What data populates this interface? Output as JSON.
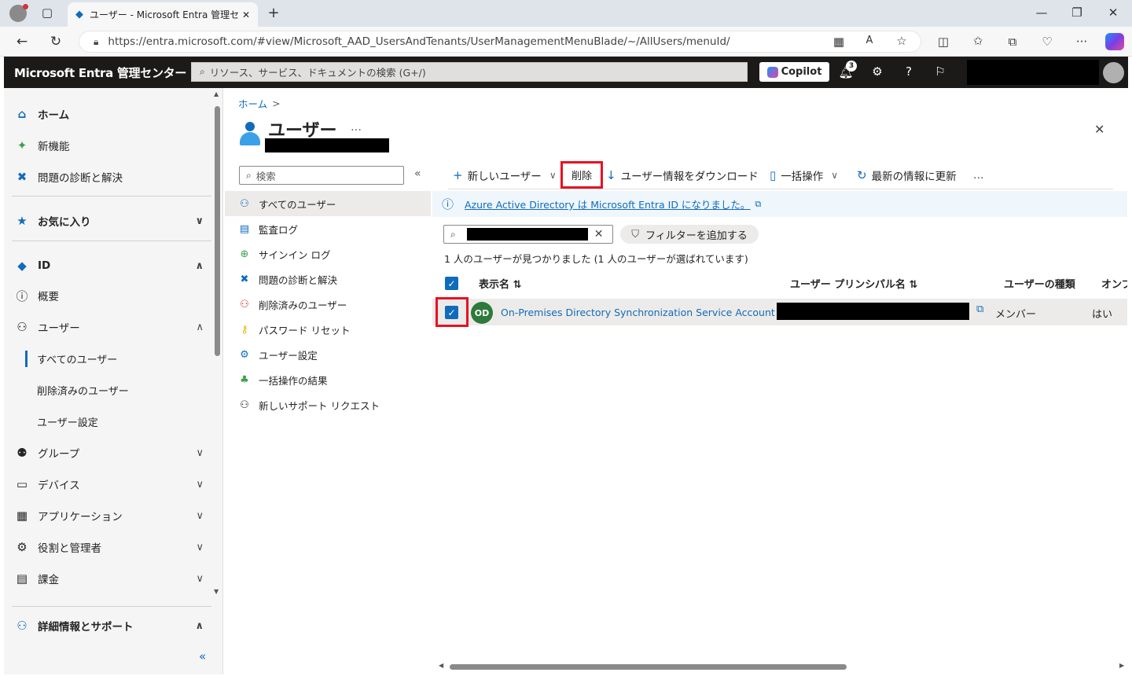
{
  "browser": {
    "tab_title": "ユーザー - Microsoft Entra 管理セン…",
    "url": "https://entra.microsoft.com/#view/Microsoft_AAD_UsersAndTenants/UserManagementMenuBlade/~/AllUsers/menuId/"
  },
  "header": {
    "brand": "Microsoft Entra 管理センター",
    "search_placeholder": "リソース、サービス、ドキュメントの検索 (G+/)",
    "copilot_label": "Copilot",
    "notification_count": "3"
  },
  "left_nav": {
    "items": [
      {
        "label": "ホーム",
        "icon": "home-icon"
      },
      {
        "label": "新機能",
        "icon": "sparkle-icon"
      },
      {
        "label": "問題の診断と解決",
        "icon": "diagnose-icon"
      },
      {
        "label": "お気に入り",
        "icon": "star-icon"
      },
      {
        "label": "ID",
        "icon": "identity-icon"
      },
      {
        "label": "概要",
        "icon": "info-icon"
      },
      {
        "label": "ユーザー",
        "icon": "user-icon"
      },
      {
        "label": "すべてのユーザー"
      },
      {
        "label": "削除済みのユーザー"
      },
      {
        "label": "ユーザー設定"
      },
      {
        "label": "グループ",
        "icon": "group-icon"
      },
      {
        "label": "デバイス",
        "icon": "device-icon"
      },
      {
        "label": "アプリケーション",
        "icon": "apps-icon"
      },
      {
        "label": "役割と管理者",
        "icon": "roles-icon"
      },
      {
        "label": "課金",
        "icon": "billing-icon"
      },
      {
        "label": "詳細情報とサポート",
        "icon": "support-icon"
      }
    ]
  },
  "breadcrumb": {
    "home": "ホーム",
    "sep": ">"
  },
  "page": {
    "title": "ユーザー",
    "more": "…",
    "close": "✕"
  },
  "resource_menu": {
    "search_placeholder": "検索",
    "collapse": "«",
    "items": [
      {
        "label": "すべてのユーザー",
        "icon": "users-icon"
      },
      {
        "label": "監査ログ",
        "icon": "audit-log-icon"
      },
      {
        "label": "サインイン ログ",
        "icon": "signin-log-icon"
      },
      {
        "label": "問題の診断と解決",
        "icon": "diagnose-icon"
      },
      {
        "label": "削除済みのユーザー",
        "icon": "deleted-user-icon"
      },
      {
        "label": "パスワード リセット",
        "icon": "key-icon"
      },
      {
        "label": "ユーザー設定",
        "icon": "user-settings-icon"
      },
      {
        "label": "一括操作の結果",
        "icon": "bulk-results-icon"
      },
      {
        "label": "新しいサポート リクエスト",
        "icon": "support-request-icon"
      }
    ]
  },
  "toolbar": {
    "new_user": "新しいユーザー",
    "delete": "削除",
    "download": "ユーザー情報をダウンロード",
    "bulk": "一括操作",
    "refresh": "最新の情報に更新",
    "more": "…"
  },
  "info_banner": {
    "text": "Azure Active Directory は Microsoft Entra ID になりました。"
  },
  "filter": {
    "add_filter": "フィルターを追加する"
  },
  "result_summary": "1 人のユーザーが見つかりました (1 人のユーザーが選ばれています)",
  "table": {
    "columns": [
      "表示名 ⇅",
      "ユーザー プリンシパル名 ⇅",
      "ユーザーの種類",
      "オンプ"
    ],
    "rows": [
      {
        "initials": "OD",
        "display_name": "On-Premises Directory Synchronization Service Account",
        "user_type": "メンバー",
        "onprem": "はい",
        "selected": true
      }
    ]
  },
  "colors": {
    "accent": "#0f6cbd",
    "highlight": "#e81123",
    "header_bg": "#1b1a19",
    "avatar": "#2d7a3a"
  }
}
